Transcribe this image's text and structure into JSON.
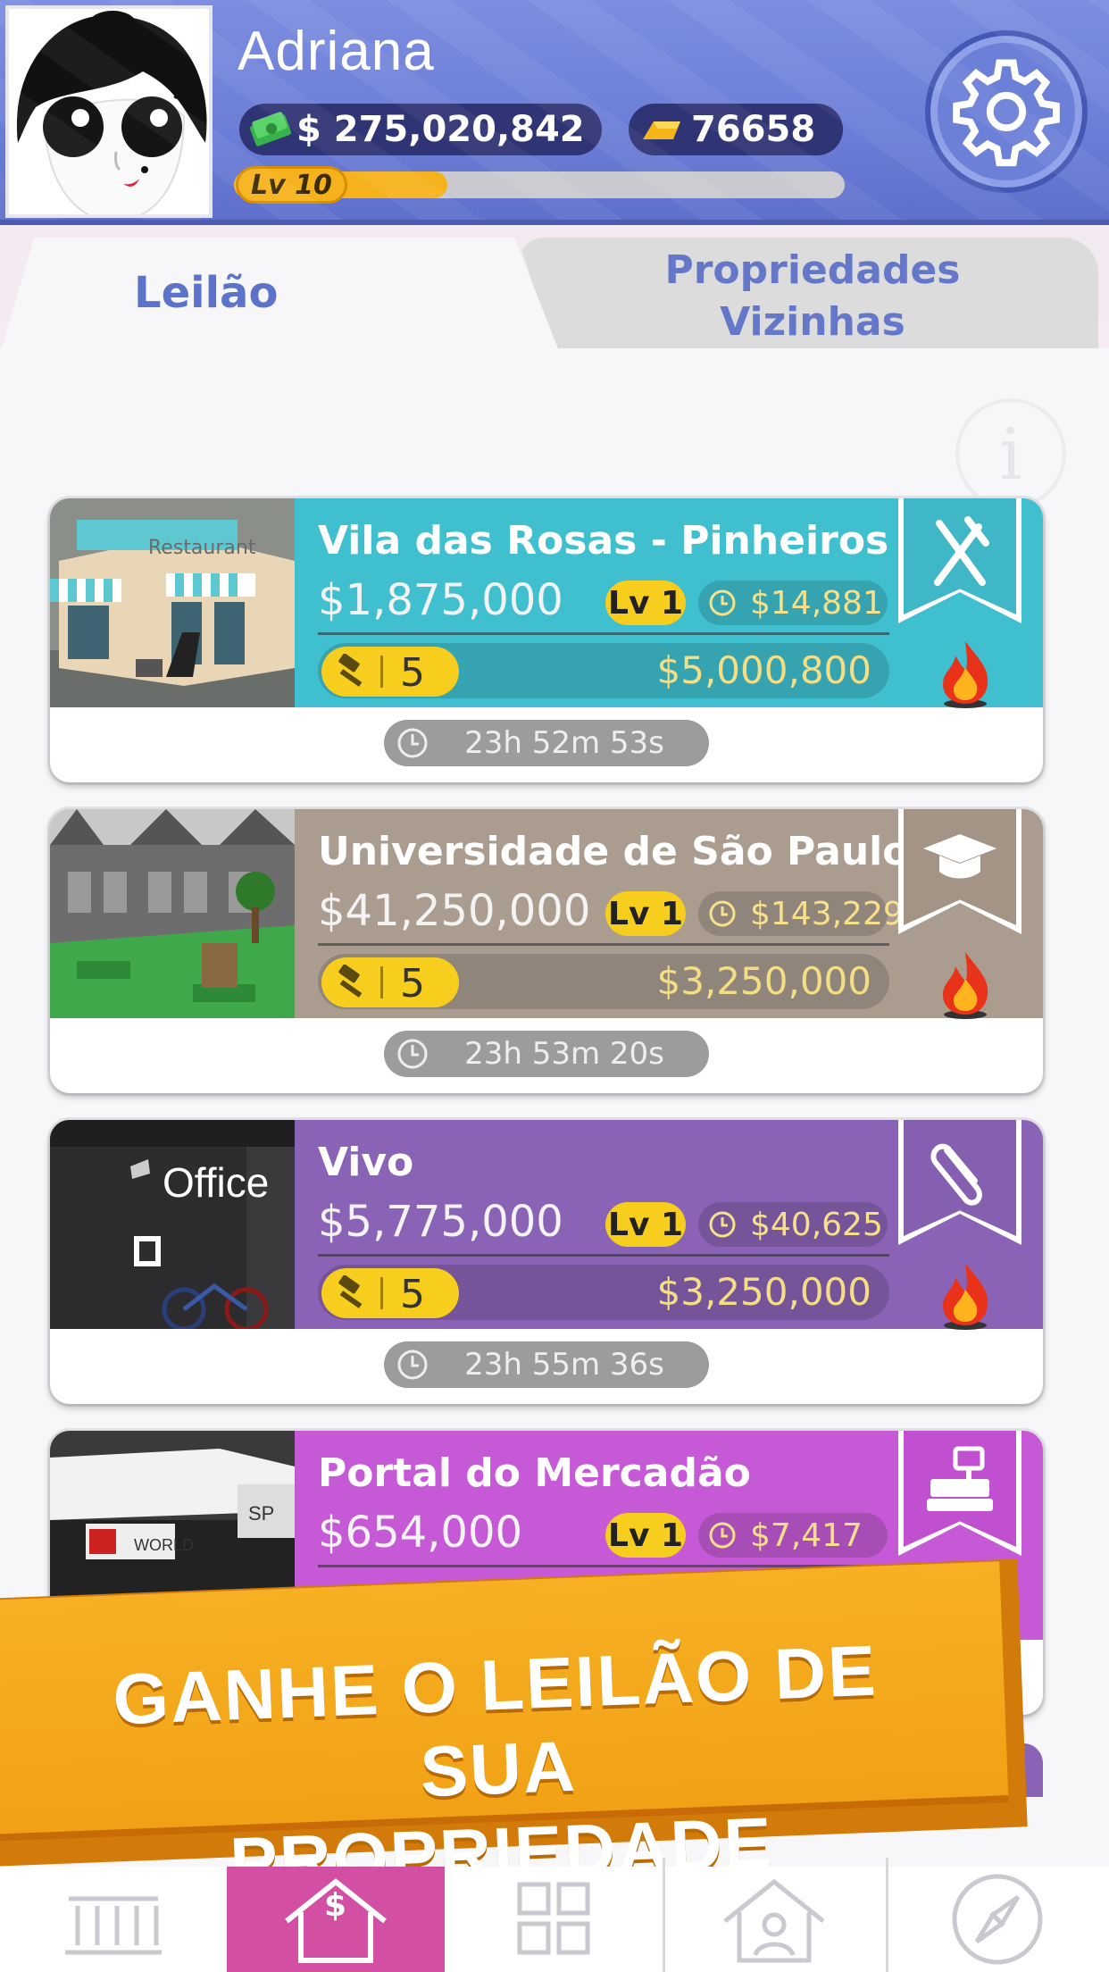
{
  "player": {
    "name": "Adriana",
    "money": "$ 275,020,842",
    "gold": "76658",
    "level_label": "Lv 10",
    "xp_progress": 0.35
  },
  "tabs": [
    {
      "label": "Leilão",
      "active": true
    },
    {
      "label": "Propriedades Vizinhas",
      "active": false
    }
  ],
  "info_icon": "info-icon",
  "auctions": [
    {
      "title": "Vila das Rosas - Pinheiros",
      "price": "$1,875,000",
      "level": "Lv 1",
      "income": "$14,881",
      "bids": "5",
      "bid_value": "$5,000,800",
      "timer": "23h 52m 53s",
      "category_icon": "fork-knife-icon",
      "band_color": "#40c0cf",
      "ribbon_color": "#3fb7c6"
    },
    {
      "title": "Universidade de São Paulo",
      "price": "$41,250,000",
      "level": "Lv 1",
      "income": "$143,229",
      "bids": "5",
      "bid_value": "$3,250,000",
      "timer": "23h 53m 20s",
      "category_icon": "graduation-cap-icon",
      "band_color": "#aa9d90",
      "ribbon_color": "#a39485"
    },
    {
      "title": "Vivo",
      "price": "$5,775,000",
      "level": "Lv 1",
      "income": "$40,625",
      "bids": "5",
      "bid_value": "$3,250,000",
      "timer": "23h 55m 36s",
      "category_icon": "paperclip-icon",
      "band_color": "#8b63b6",
      "ribbon_color": "#8660b0"
    },
    {
      "title": "Portal do Mercadão",
      "price": "$654,000",
      "level": "Lv 1",
      "income": "$7,417",
      "bids": "",
      "bid_value": "",
      "timer": "",
      "category_icon": "cash-register-icon",
      "band_color": "#c65ad6",
      "ribbon_color": "#c050d0"
    }
  ],
  "banner": {
    "line1": "GANHE O LEILÃO DE SUA",
    "line2": "PROPRIEDADE FAVORITA"
  },
  "bottom_nav": [
    {
      "icon": "bank-icon",
      "active": false
    },
    {
      "icon": "house-dollar-icon",
      "active": true
    },
    {
      "icon": "grid-icon",
      "active": false
    },
    {
      "icon": "house-person-icon",
      "active": false
    },
    {
      "icon": "compass-icon",
      "active": false
    }
  ]
}
